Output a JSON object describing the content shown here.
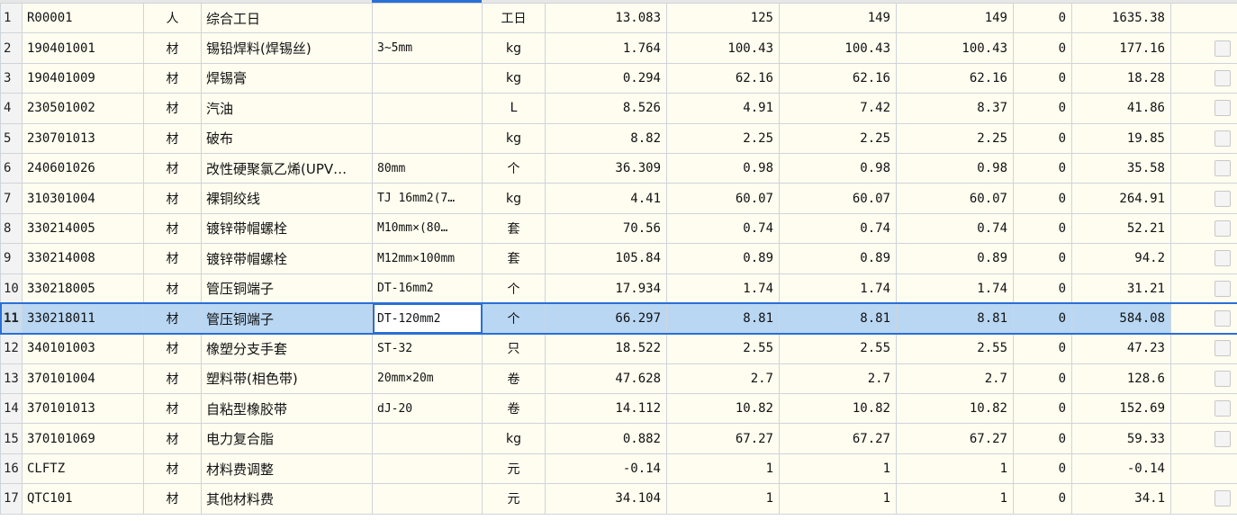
{
  "rows": [
    {
      "no": "1",
      "code": "R00001",
      "type": "人",
      "name": "综合工日",
      "spec": "",
      "unit": "工日",
      "qty": "13.083",
      "p1": "125",
      "p2": "149",
      "p3": "149",
      "diff": "0",
      "total": "1635.38",
      "check": false
    },
    {
      "no": "2",
      "code": "190401001",
      "type": "材",
      "name": "锡铅焊料(焊锡丝)",
      "spec": "3~5mm",
      "unit": "kg",
      "qty": "1.764",
      "p1": "100.43",
      "p2": "100.43",
      "p3": "100.43",
      "diff": "0",
      "total": "177.16",
      "check": true
    },
    {
      "no": "3",
      "code": "190401009",
      "type": "材",
      "name": "焊锡膏",
      "spec": "",
      "unit": "kg",
      "qty": "0.294",
      "p1": "62.16",
      "p2": "62.16",
      "p3": "62.16",
      "diff": "0",
      "total": "18.28",
      "check": true
    },
    {
      "no": "4",
      "code": "230501002",
      "type": "材",
      "name": "汽油",
      "spec": "",
      "unit": "L",
      "qty": "8.526",
      "p1": "4.91",
      "p2": "7.42",
      "p3": "8.37",
      "diff": "0",
      "total": "41.86",
      "check": true
    },
    {
      "no": "5",
      "code": "230701013",
      "type": "材",
      "name": "破布",
      "spec": "",
      "unit": "kg",
      "qty": "8.82",
      "p1": "2.25",
      "p2": "2.25",
      "p3": "2.25",
      "diff": "0",
      "total": "19.85",
      "check": true
    },
    {
      "no": "6",
      "code": "240601026",
      "type": "材",
      "name": "改性硬聚氯乙烯(UPV…",
      "spec": "80mm",
      "unit": "个",
      "qty": "36.309",
      "p1": "0.98",
      "p2": "0.98",
      "p3": "0.98",
      "diff": "0",
      "total": "35.58",
      "check": true
    },
    {
      "no": "7",
      "code": "310301004",
      "type": "材",
      "name": "裸铜绞线",
      "spec": "TJ 16mm2(7…",
      "unit": "kg",
      "qty": "4.41",
      "p1": "60.07",
      "p2": "60.07",
      "p3": "60.07",
      "diff": "0",
      "total": "264.91",
      "check": true
    },
    {
      "no": "8",
      "code": "330214005",
      "type": "材",
      "name": "镀锌带帽螺栓",
      "spec": "M10mm×(80…",
      "unit": "套",
      "qty": "70.56",
      "p1": "0.74",
      "p2": "0.74",
      "p3": "0.74",
      "diff": "0",
      "total": "52.21",
      "check": true
    },
    {
      "no": "9",
      "code": "330214008",
      "type": "材",
      "name": "镀锌带帽螺栓",
      "spec": "M12mm×100mm",
      "unit": "套",
      "qty": "105.84",
      "p1": "0.89",
      "p2": "0.89",
      "p3": "0.89",
      "diff": "0",
      "total": "94.2",
      "check": true
    },
    {
      "no": "10",
      "code": "330218005",
      "type": "材",
      "name": "管压铜端子",
      "spec": "DT-16mm2",
      "unit": "个",
      "qty": "17.934",
      "p1": "1.74",
      "p2": "1.74",
      "p3": "1.74",
      "diff": "0",
      "total": "31.21",
      "check": true
    },
    {
      "no": "11",
      "code": "330218011",
      "type": "材",
      "name": "管压铜端子",
      "spec": "DT-120mm2",
      "unit": "个",
      "qty": "66.297",
      "p1": "8.81",
      "p2": "8.81",
      "p3": "8.81",
      "diff": "0",
      "total": "584.08",
      "check": true,
      "selected": true
    },
    {
      "no": "12",
      "code": "340101003",
      "type": "材",
      "name": "橡塑分支手套",
      "spec": "ST-32",
      "unit": "只",
      "qty": "18.522",
      "p1": "2.55",
      "p2": "2.55",
      "p3": "2.55",
      "diff": "0",
      "total": "47.23",
      "check": true
    },
    {
      "no": "13",
      "code": "370101004",
      "type": "材",
      "name": "塑料带(相色带)",
      "spec": "20mm×20m",
      "unit": "卷",
      "qty": "47.628",
      "p1": "2.7",
      "p2": "2.7",
      "p3": "2.7",
      "diff": "0",
      "total": "128.6",
      "check": true
    },
    {
      "no": "14",
      "code": "370101013",
      "type": "材",
      "name": "自粘型橡胶带",
      "spec": "dJ-20",
      "unit": "卷",
      "qty": "14.112",
      "p1": "10.82",
      "p2": "10.82",
      "p3": "10.82",
      "diff": "0",
      "total": "152.69",
      "check": true
    },
    {
      "no": "15",
      "code": "370101069",
      "type": "材",
      "name": "电力复合脂",
      "spec": "",
      "unit": "kg",
      "qty": "0.882",
      "p1": "67.27",
      "p2": "67.27",
      "p3": "67.27",
      "diff": "0",
      "total": "59.33",
      "check": true
    },
    {
      "no": "16",
      "code": "CLFTZ",
      "type": "材",
      "name": "材料费调整",
      "spec": "",
      "unit": "元",
      "qty": "-0.14",
      "p1": "1",
      "p2": "1",
      "p3": "1",
      "diff": "0",
      "total": "-0.14",
      "check": false
    },
    {
      "no": "17",
      "code": "QTC101",
      "type": "材",
      "name": "其他材料费",
      "spec": "",
      "unit": "元",
      "qty": "34.104",
      "p1": "1",
      "p2": "1",
      "p3": "1",
      "diff": "0",
      "total": "34.1",
      "check": true
    }
  ]
}
